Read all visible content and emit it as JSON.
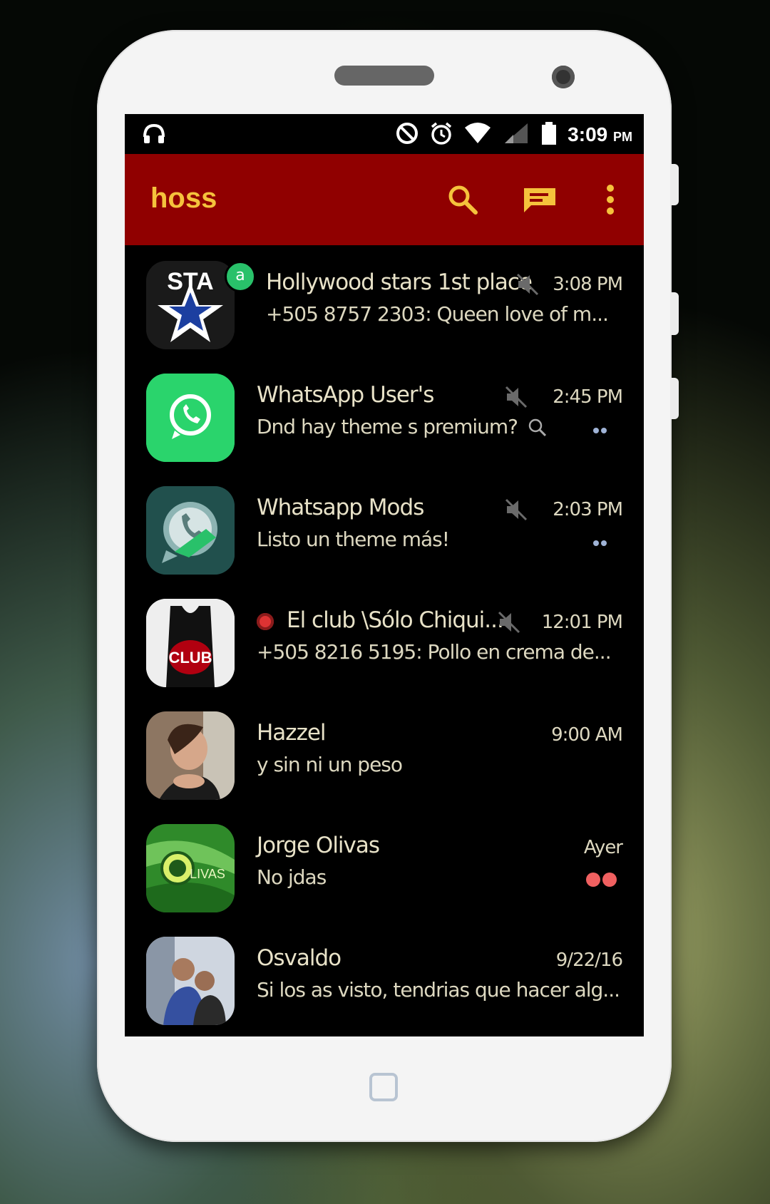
{
  "status_bar": {
    "time": "3:09",
    "ampm": "PM",
    "icons": [
      "headset-icon",
      "do-not-disturb-icon",
      "alarm-icon",
      "wifi-icon",
      "signal-icon",
      "battery-icon"
    ]
  },
  "toolbar": {
    "title": "hoss",
    "actions": [
      "search-icon",
      "new-chat-icon",
      "more-options-icon"
    ],
    "background": "#900000",
    "accent": "#f5c23c"
  },
  "chats": [
    {
      "name": "Hollywood stars 1st place",
      "message": "+505 8757 2303: Queen love of m...",
      "time": "3:08 PM",
      "muted": true,
      "badge": "a",
      "avatar": "star-logo"
    },
    {
      "name": "WhatsApp User's",
      "message": "Dnd hay theme s premium?",
      "time": "2:45 PM",
      "muted": true,
      "unread_dots": "blue",
      "avatar": "whatsapp-logo"
    },
    {
      "name": "Whatsapp Mods",
      "message": "Listo un theme más!",
      "time": "2:03 PM",
      "muted": true,
      "unread_dots": "blue",
      "avatar": "whatsapp-mods-logo"
    },
    {
      "name": "El club \\Sólo Chiqui...",
      "message": "+505 8216 5195: Pollo en crema de...",
      "time": "12:01 PM",
      "muted": true,
      "avatar": "club-shirt"
    },
    {
      "name": "Hazzel",
      "message": "y sin ni un peso",
      "time": "9:00 AM",
      "avatar": "photo-woman"
    },
    {
      "name": "Jorge Olivas",
      "message": "No jdas",
      "time": "Ayer",
      "unread_dots": "red",
      "avatar": "green-logo"
    },
    {
      "name": "Osvaldo",
      "message": "Si los as visto, tendrias que hacer alg...",
      "time": "9/22/16",
      "avatar": "photo-couple"
    }
  ]
}
